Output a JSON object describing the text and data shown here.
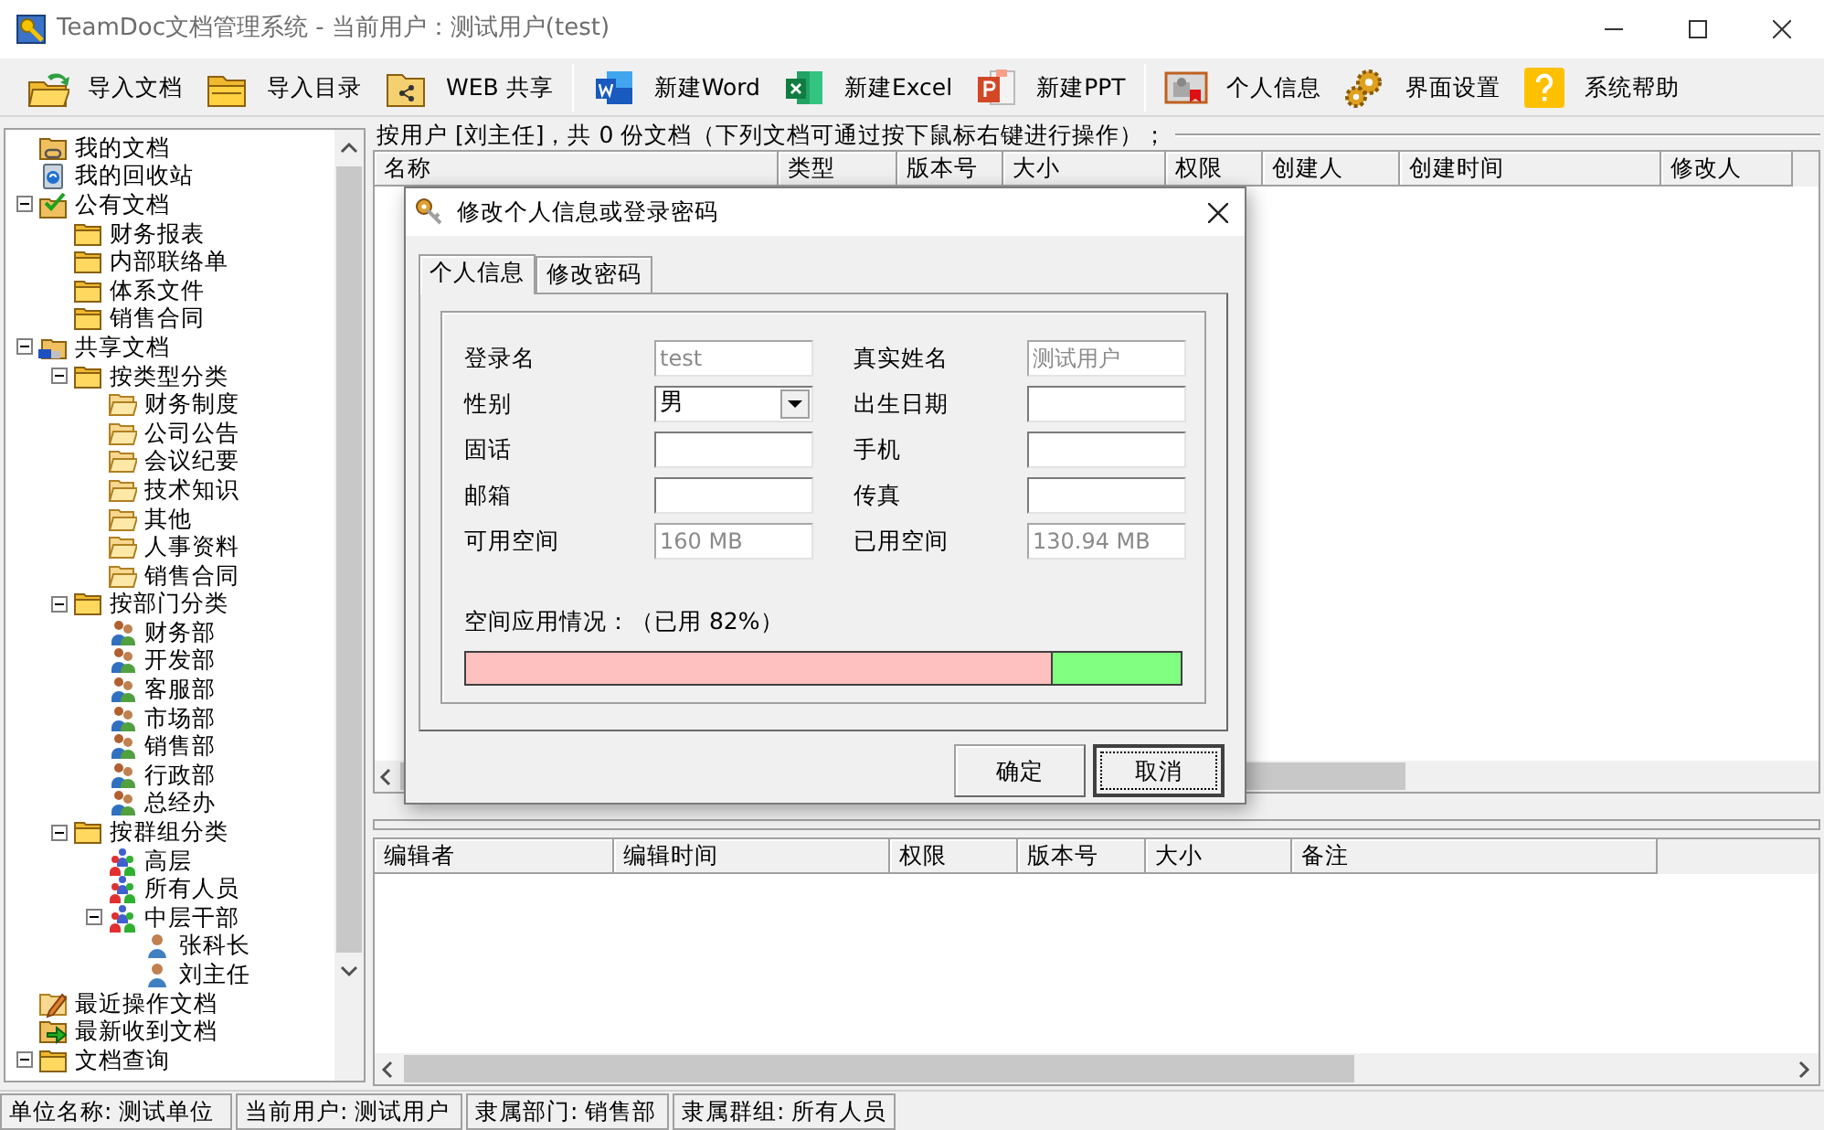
{
  "window": {
    "title": "TeamDoc文档管理系统 - 当前用户：测试用户(test)"
  },
  "toolbar": {
    "groups": [
      {
        "items": [
          {
            "label": "导入文档",
            "kind": "import"
          },
          {
            "label": "导入目录",
            "kind": "folder"
          },
          {
            "label": "WEB 共享",
            "kind": "share"
          }
        ]
      },
      {
        "items": [
          {
            "label": "新建Word",
            "kind": "word"
          },
          {
            "label": "新建Excel",
            "kind": "excel"
          },
          {
            "label": "新建PPT",
            "kind": "ppt"
          }
        ]
      },
      {
        "items": [
          {
            "label": "个人信息",
            "kind": "profile"
          },
          {
            "label": "界面设置",
            "kind": "settings"
          },
          {
            "label": "系统帮助",
            "kind": "help"
          }
        ]
      }
    ]
  },
  "tree": [
    {
      "label": "我的文档",
      "kind": "mydocs"
    },
    {
      "label": "我的回收站",
      "kind": "recycle"
    },
    {
      "label": "公有文档",
      "kind": "public",
      "expanded": true,
      "children": [
        {
          "label": "财务报表",
          "kind": "folder"
        },
        {
          "label": "内部联络单",
          "kind": "folder"
        },
        {
          "label": "体系文件",
          "kind": "folder"
        },
        {
          "label": "销售合同",
          "kind": "folder"
        }
      ]
    },
    {
      "label": "共享文档",
      "kind": "shared",
      "expanded": true,
      "children": [
        {
          "label": "按类型分类",
          "kind": "folder",
          "expanded": true,
          "children": [
            {
              "label": "财务制度",
              "kind": "openfolder"
            },
            {
              "label": "公司公告",
              "kind": "openfolder"
            },
            {
              "label": "会议纪要",
              "kind": "openfolder"
            },
            {
              "label": "技术知识",
              "kind": "openfolder"
            },
            {
              "label": "其他",
              "kind": "openfolder"
            },
            {
              "label": "人事资料",
              "kind": "openfolder"
            },
            {
              "label": "销售合同",
              "kind": "openfolder"
            }
          ]
        },
        {
          "label": "按部门分类",
          "kind": "folder",
          "expanded": true,
          "children": [
            {
              "label": "财务部",
              "kind": "department"
            },
            {
              "label": "开发部",
              "kind": "department"
            },
            {
              "label": "客服部",
              "kind": "department"
            },
            {
              "label": "市场部",
              "kind": "department"
            },
            {
              "label": "销售部",
              "kind": "department"
            },
            {
              "label": "行政部",
              "kind": "department"
            },
            {
              "label": "总经办",
              "kind": "department"
            }
          ]
        },
        {
          "label": "按群组分类",
          "kind": "folder",
          "expanded": true,
          "children": [
            {
              "label": "高层",
              "kind": "group"
            },
            {
              "label": "所有人员",
              "kind": "group"
            },
            {
              "label": "中层干部",
              "kind": "group",
              "expanded": true,
              "children": [
                {
                  "label": "张科长",
                  "kind": "user"
                },
                {
                  "label": "刘主任",
                  "kind": "user"
                }
              ]
            }
          ]
        }
      ]
    },
    {
      "label": "最近操作文档",
      "kind": "recent"
    },
    {
      "label": "最新收到文档",
      "kind": "inbox"
    },
    {
      "label": "文档查询",
      "kind": "folder",
      "expanded": true
    }
  ],
  "document_list": {
    "caption": "按用户 [刘主任]，共 0 份文档（下列文档可通过按下鼠标右键进行操作）；",
    "columns": [
      "名称",
      "类型",
      "版本号",
      "大小",
      "权限",
      "创建人",
      "创建时间",
      "修改人"
    ]
  },
  "history_list": {
    "columns": [
      "编辑者",
      "编辑时间",
      "权限",
      "版本号",
      "大小",
      "备注"
    ]
  },
  "status_bar": [
    "单位名称: 测试单位",
    "当前用户: 测试用户",
    "隶属部门: 销售部",
    "隶属群组: 所有人员"
  ],
  "dialog": {
    "title": "修改个人信息或登录密码",
    "tabs": [
      {
        "label": "个人信息",
        "selected": true
      },
      {
        "label": "修改密码",
        "selected": false
      }
    ],
    "fields": [
      {
        "label": "登录名",
        "kind": "text",
        "value": "test",
        "readonly": true
      },
      {
        "label": "真实姓名",
        "kind": "text",
        "value": "测试用户",
        "readonly": true
      },
      {
        "label": "性别",
        "kind": "select",
        "value": "男"
      },
      {
        "label": "出生日期",
        "kind": "text"
      },
      {
        "label": "固话",
        "kind": "text"
      },
      {
        "label": "手机",
        "kind": "text"
      },
      {
        "label": "邮箱",
        "kind": "text"
      },
      {
        "label": "传真",
        "kind": "text"
      },
      {
        "label": "可用空间",
        "kind": "text",
        "value": "160 MB",
        "readonly": true
      },
      {
        "label": "已用空间",
        "kind": "text",
        "value": "130.94 MB",
        "readonly": true
      }
    ],
    "usage": {
      "label": "空间应用情况：（已用 82%）",
      "level": 0.82
    },
    "buttons": [
      {
        "label": "确定",
        "focused": false
      },
      {
        "label": "取消",
        "focused": true
      }
    ]
  }
}
